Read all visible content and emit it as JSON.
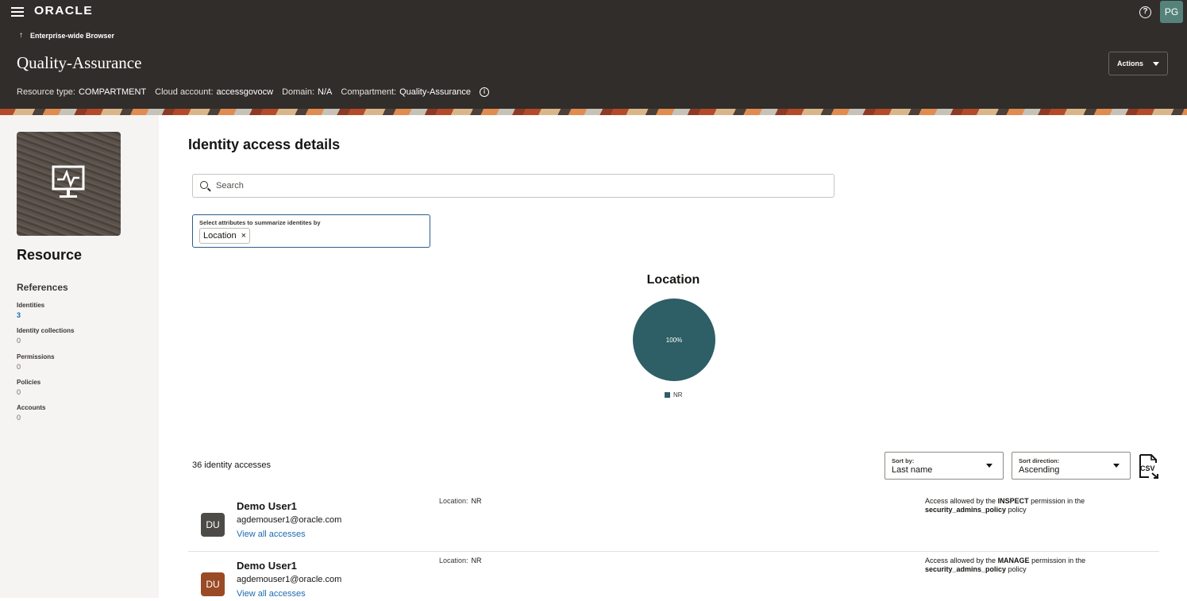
{
  "header": {
    "logo": "ORACLE",
    "breadcrumb": "Enterprise-wide Browser",
    "title": "Quality-Assurance",
    "actions_label": "Actions",
    "user_initials": "PG",
    "help_glyph": "?",
    "meta": {
      "resource_type_label": "Resource type:",
      "resource_type": "COMPARTMENT",
      "cloud_account_label": "Cloud account:",
      "cloud_account": "accessgovocw",
      "domain_label": "Domain:",
      "domain": "N/A",
      "compartment_label": "Compartment:",
      "compartment": "Quality-Assurance"
    }
  },
  "sidebar": {
    "title": "Resource",
    "references_title": "References",
    "references": [
      {
        "label": "Identities",
        "value": "3"
      },
      {
        "label": "Identity collections",
        "value": "0"
      },
      {
        "label": "Permissions",
        "value": "0"
      },
      {
        "label": "Policies",
        "value": "0"
      },
      {
        "label": "Accounts",
        "value": "0"
      }
    ]
  },
  "main": {
    "title": "Identity access details",
    "search_placeholder": "Search",
    "attr_label": "Select attributes to summarize identites by",
    "chip_label": "Location",
    "chip_remove": "×",
    "count_text": "36 identity accesses",
    "sort_by_label": "Sort by:",
    "sort_by_value": "Last name",
    "sort_dir_label": "Sort direction:",
    "sort_dir_value": "Ascending"
  },
  "chart_data": {
    "type": "pie",
    "title": "Location",
    "categories": [
      "NR"
    ],
    "values": [
      100
    ],
    "data_labels": [
      "100%"
    ],
    "colors": [
      "#2e5e66"
    ],
    "legend_position": "bottom"
  },
  "rows": [
    {
      "initials": "DU",
      "avatar_color": "#4d4b47",
      "name": "Demo User1",
      "email": "agdemouser1@oracle.com",
      "link": "View all accesses",
      "location_label": "Location:",
      "location": "NR",
      "access_prefix": "Access allowed by the",
      "permission": "INSPECT",
      "access_middle": "permission in the",
      "policy": "security_admins_policy",
      "access_suffix": "policy"
    },
    {
      "initials": "DU",
      "avatar_color": "#9a4a25",
      "name": "Demo User1",
      "email": "agdemouser1@oracle.com",
      "link": "View all accesses",
      "location_label": "Location:",
      "location": "NR",
      "access_prefix": "Access allowed by the",
      "permission": "MANAGE",
      "access_middle": "permission in the",
      "policy": "security_admins_policy",
      "access_suffix": "policy"
    }
  ]
}
